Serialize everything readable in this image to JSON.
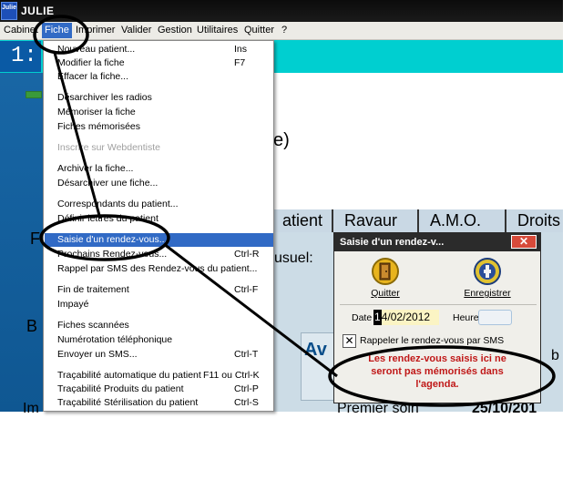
{
  "window": {
    "title": "JULIE",
    "app_icon_text": "Julie"
  },
  "menubar": {
    "items": [
      {
        "label": "Cabinet"
      },
      {
        "label": "Fiche"
      },
      {
        "label": "Imprimer"
      },
      {
        "label": "Valider"
      },
      {
        "label": "Gestion"
      },
      {
        "label": "Utilitaires"
      },
      {
        "label": "Quitter"
      },
      {
        "label": "?"
      }
    ]
  },
  "background": {
    "number": "1:",
    "fragments": {
      "e_paren": "e)",
      "atient": "atient",
      "ravaur": "Ravaur",
      "amo": "A.M.O.",
      "droits": "Droits",
      "f": "F",
      "usuel": "usuel:",
      "b": "B",
      "av": "Av",
      "im": "Im",
      "premier_soin": "Premier soin",
      "date_frag": "25/10/201",
      "b2": "b"
    }
  },
  "fiche_menu": {
    "items": [
      {
        "label": "Nouveau patient...",
        "shortcut": "Ins"
      },
      {
        "label": "Modifier la fiche",
        "shortcut": "F7"
      },
      {
        "label": "Effacer la fiche...",
        "shortcut": ""
      },
      {
        "label": "Désarchiver les radios",
        "shortcut": ""
      },
      {
        "label": "Mémoriser la fiche",
        "shortcut": ""
      },
      {
        "label": "Fiches mémorisées",
        "shortcut": ""
      },
      {
        "label": "Inscrire sur Webdentiste",
        "shortcut": "",
        "disabled": true
      },
      {
        "label": "Archiver la fiche...",
        "shortcut": ""
      },
      {
        "label": "Désarchiver une fiche...",
        "shortcut": ""
      },
      {
        "label": "Correspondants du patient...",
        "shortcut": ""
      },
      {
        "label": "Définir lettres du patient",
        "shortcut": ""
      },
      {
        "label": "Saisie d'un rendez-vous...",
        "shortcut": "",
        "selected": true
      },
      {
        "label": "Prochains Rendez-vous...",
        "shortcut": "Ctrl-R"
      },
      {
        "label": "Rappel par SMS des Rendez-vous du patient...",
        "shortcut": ""
      },
      {
        "label": "Fin de traitement",
        "shortcut": "Ctrl-F"
      },
      {
        "label": "Impayé",
        "shortcut": ""
      },
      {
        "label": "Fiches scannées",
        "shortcut": ""
      },
      {
        "label": "Numérotation téléphonique",
        "shortcut": ""
      },
      {
        "label": "Envoyer un SMS...",
        "shortcut": "Ctrl-T"
      },
      {
        "label": "Traçabilité automatique du patient",
        "shortcut": "F11 ou Ctrl-K"
      },
      {
        "label": "Traçabilité Produits du patient",
        "shortcut": "Ctrl-P"
      },
      {
        "label": "Traçabilité Stérilisation du patient",
        "shortcut": "Ctrl-S"
      }
    ]
  },
  "dialog": {
    "title": "Saisie d'un rendez-v...",
    "close_glyph": "✕",
    "quit_label": "Quitter",
    "save_label": "Enregistrer",
    "date_label": "Date",
    "date_caret": "1",
    "date_rest": "4/02/2012",
    "heure_label": "Heure",
    "heure_value": "",
    "checkbox_mark": "✕",
    "checkbox_label": "Rappeler le rendez-vous par SMS",
    "message_line1": "Les rendez-vous saisis ici  ne",
    "message_line2": "seront pas mémorisés dans",
    "message_line3": "l'agenda."
  },
  "colors": {
    "menu_highlight": "#316ac5",
    "message_red": "#c01818",
    "teal_banner": "#00cfd0",
    "annotation": "#000000"
  }
}
